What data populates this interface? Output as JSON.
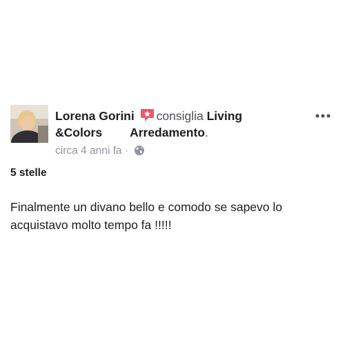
{
  "post": {
    "author": "Lorena Gorini",
    "recommends_text": "consiglia",
    "page_name_part1": "Living",
    "page_name_part2": "&Colors",
    "page_name_part3": "Arredamento",
    "page_name_suffix": ".",
    "timestamp": "circa 4 anni fa",
    "separator": "·",
    "privacy_icon": "globe-icon",
    "more_icon": "more-options-icon",
    "rating": "5 stelle",
    "body": "Finalmente un divano bello e comodo se sapevo lo acquistavo molto tempo fa !!!!!"
  },
  "colors": {
    "recommend_icon": "#f0566f",
    "meta_text": "#90949c"
  }
}
